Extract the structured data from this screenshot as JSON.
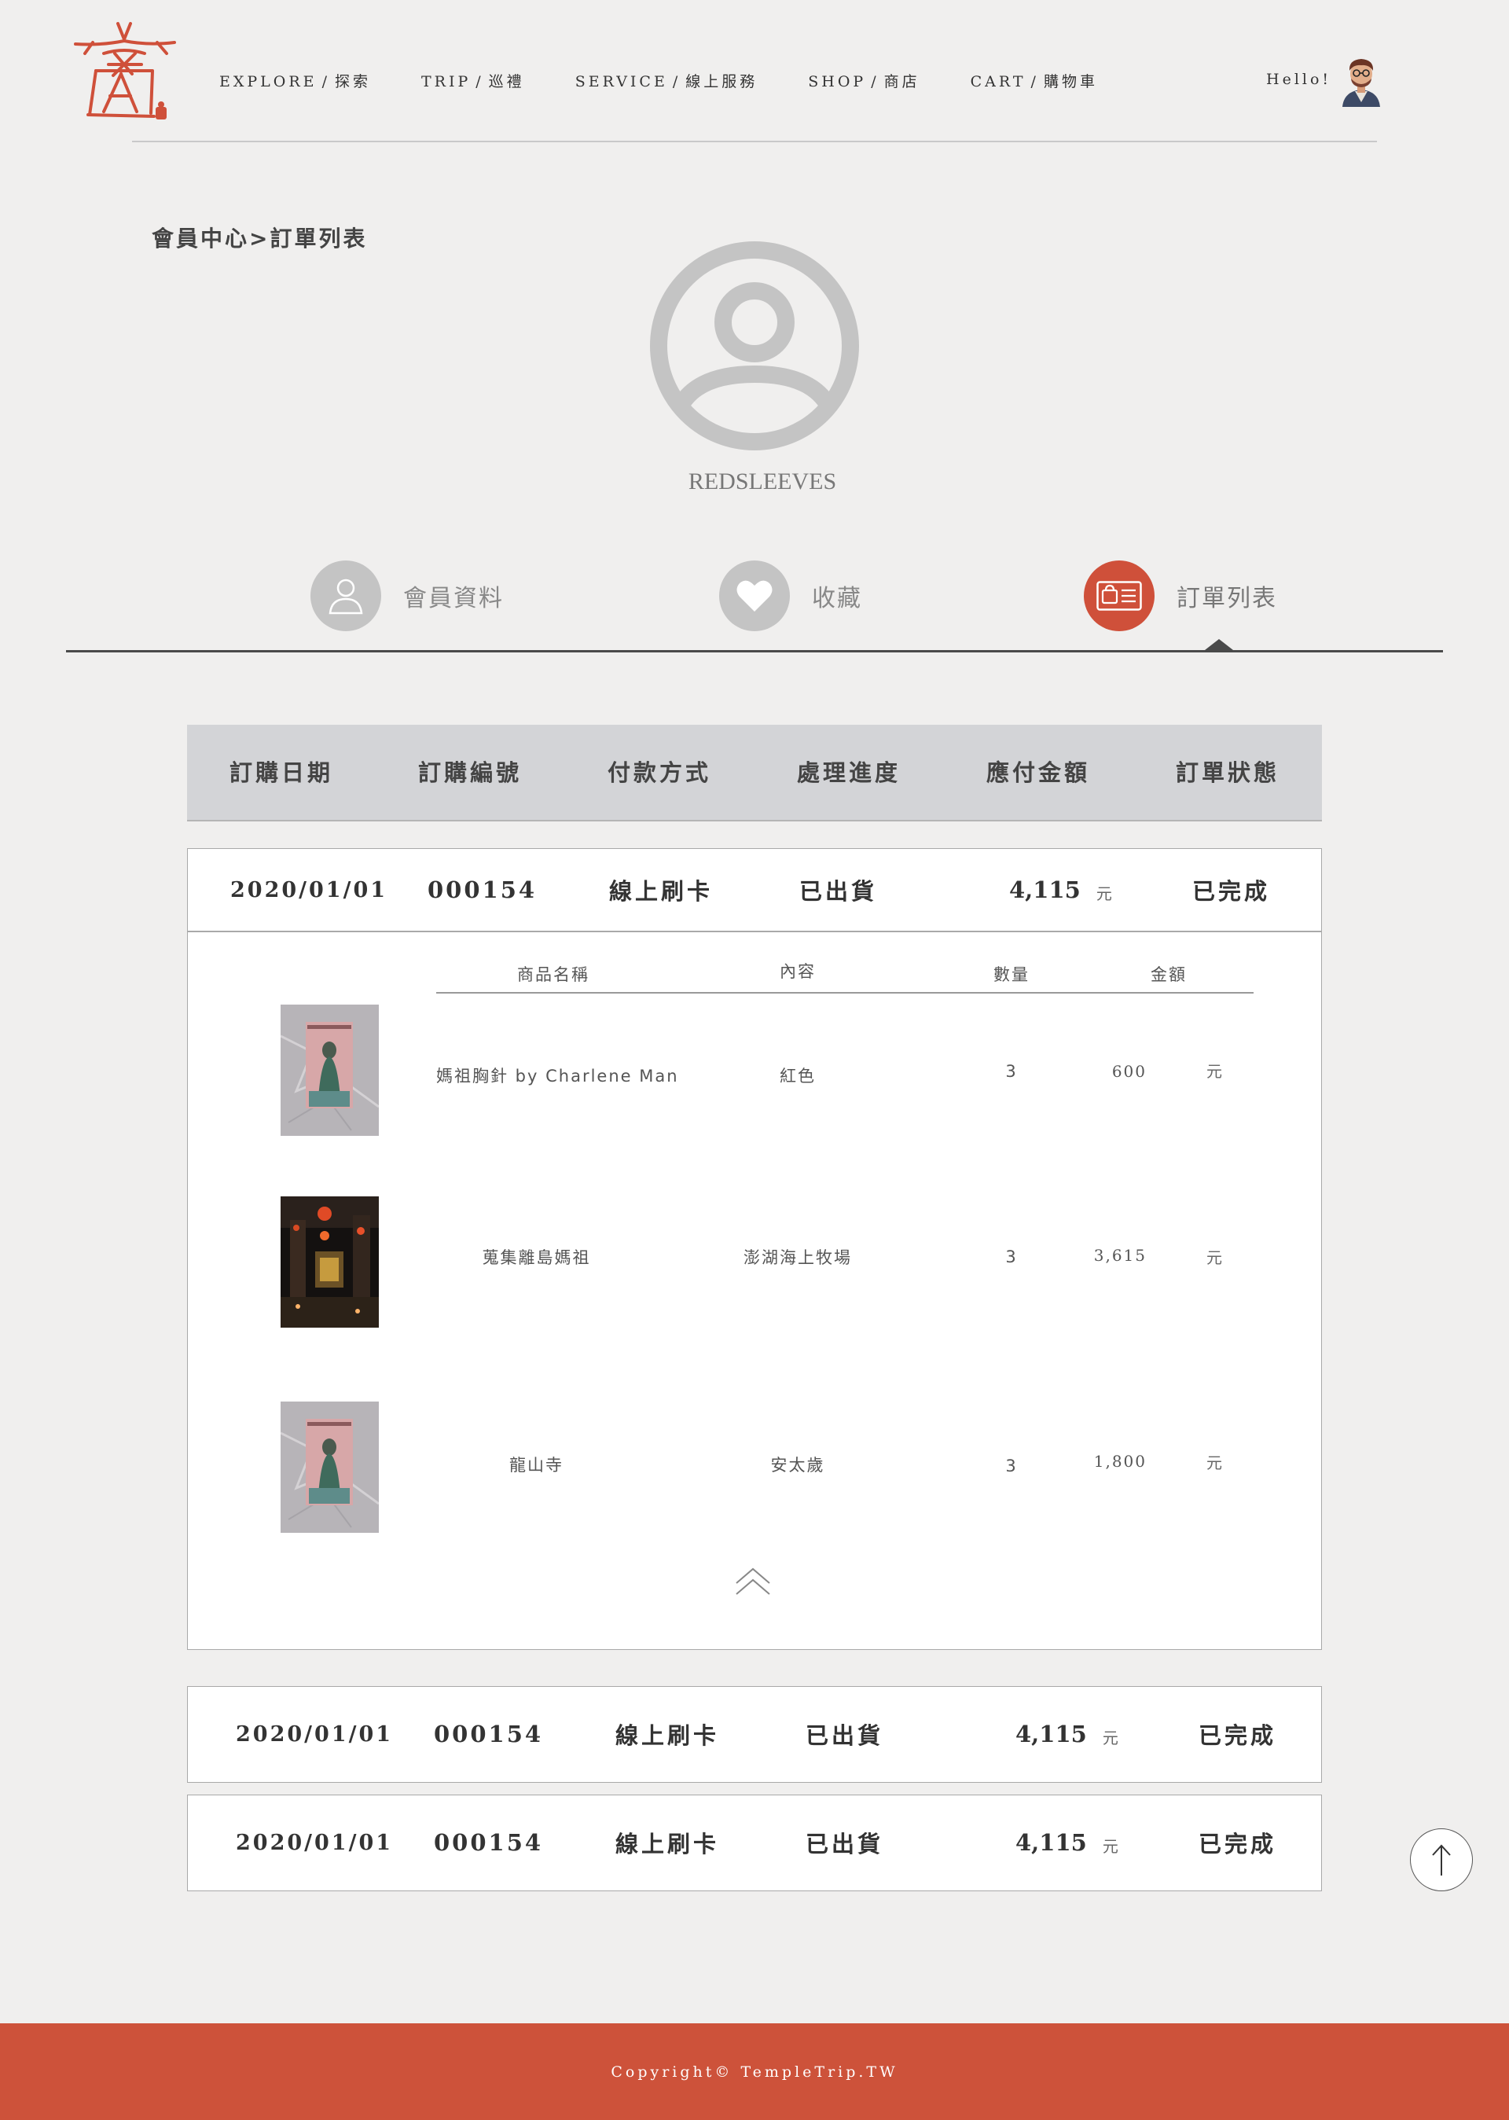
{
  "nav": {
    "items": [
      {
        "en": "EXPLORE",
        "zh": "探索"
      },
      {
        "en": "TRIP",
        "zh": "巡禮"
      },
      {
        "en": "SERVICE",
        "zh": "線上服務"
      },
      {
        "en": "SHOP",
        "zh": "商店"
      },
      {
        "en": "CART",
        "zh": "購物車"
      }
    ],
    "separator": "/",
    "greeting": "Hello!"
  },
  "profile": {
    "breadcrumb": "會員中心>訂單列表",
    "username": "REDSLEEVES"
  },
  "tabs": [
    {
      "label": "會員資料",
      "icon": "user-icon",
      "active": false
    },
    {
      "label": "收藏",
      "icon": "heart-icon",
      "active": false
    },
    {
      "label": "訂單列表",
      "icon": "order-card-icon",
      "active": true
    }
  ],
  "table": {
    "headers": [
      "訂購日期",
      "訂購編號",
      "付款方式",
      "處理進度",
      "應付金額",
      "訂單狀態"
    ],
    "currency": "元",
    "orders": [
      {
        "date": "2020/01/01",
        "number": "000154",
        "payment": "線上刷卡",
        "progress": "已出貨",
        "amount": "4,115",
        "status": "已完成",
        "expanded": true
      },
      {
        "date": "2020/01/01",
        "number": "000154",
        "payment": "線上刷卡",
        "progress": "已出貨",
        "amount": "4,115",
        "status": "已完成",
        "expanded": false
      },
      {
        "date": "2020/01/01",
        "number": "000154",
        "payment": "線上刷卡",
        "progress": "已出貨",
        "amount": "4,115",
        "status": "已完成",
        "expanded": false
      }
    ],
    "detail": {
      "headers": [
        "商品名稱",
        "內容",
        "數量",
        "金額"
      ],
      "items": [
        {
          "name": "媽祖胸針 by Charlene Man",
          "content": "紅色",
          "qty": "3",
          "price": "600",
          "thumb": "charlene-man-card-image"
        },
        {
          "name": "蒐集離島媽祖",
          "content": "澎湖海上牧場",
          "qty": "3",
          "price": "3,615",
          "thumb": "temple-night-photo"
        },
        {
          "name": "龍山寺",
          "content": "安太歲",
          "qty": "3",
          "price": "1,800",
          "thumb": "charlene-man-card-image"
        }
      ]
    }
  },
  "footer": {
    "copyright": "Copyright© TempleTrip.TW"
  },
  "colors": {
    "accent": "#cf503a",
    "background": "#f0efee",
    "header_bar": "#d3d4d7"
  }
}
